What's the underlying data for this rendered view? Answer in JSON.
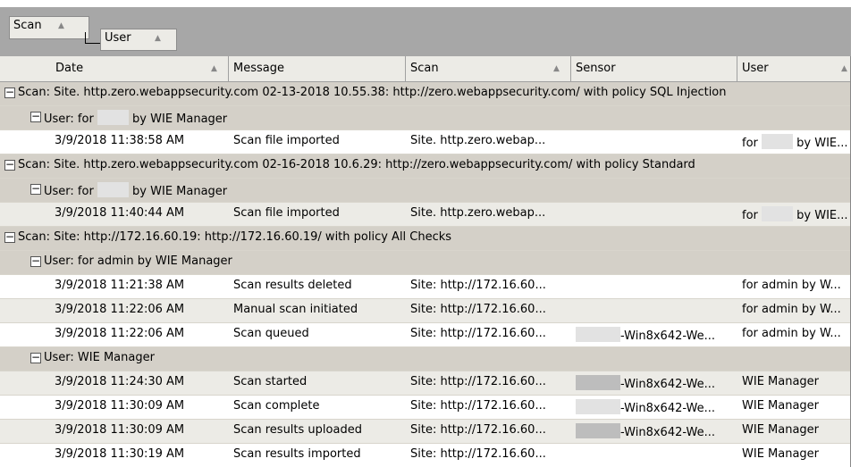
{
  "group_panel": {
    "chips": [
      {
        "label": "Scan",
        "sort": "ascending"
      },
      {
        "label": "User",
        "sort": "ascending"
      }
    ]
  },
  "columns": [
    {
      "label": "Date",
      "sort": "ascending"
    },
    {
      "label": "Message",
      "sort": ""
    },
    {
      "label": "Scan",
      "sort": "ascending"
    },
    {
      "label": "Sensor",
      "sort": ""
    },
    {
      "label": "User",
      "sort": "ascending"
    }
  ],
  "icons": {
    "sort_ascending": "▲",
    "collapse": "−"
  },
  "groups": [
    {
      "label": "Scan: Site. http.zero.webappsecurity.com 02-13-2018 10.55.38: http://zero.webappsecurity.com/ with policy SQL Injection",
      "subgroups": [
        {
          "label_before": "User: for ",
          "label_after": " by WIE Manager",
          "redacted": true,
          "rows": [
            {
              "date": "3/9/2018 11:38:58 AM",
              "message": "Scan file imported",
              "scan": "Site. http.zero.webap...",
              "sensor_before": "",
              "sensor_after": "",
              "user_before": "for ",
              "user_after": " by WIE...",
              "sensor_redacted": false,
              "user_redacted": true
            }
          ]
        }
      ]
    },
    {
      "label": "Scan: Site. http.zero.webappsecurity.com 02-16-2018 10.6.29: http://zero.webappsecurity.com/ with policy Standard",
      "subgroups": [
        {
          "label_before": "User: for ",
          "label_after": " by WIE Manager",
          "redacted": true,
          "rows": [
            {
              "date": "3/9/2018 11:40:44 AM",
              "message": "Scan file imported",
              "scan": "Site. http.zero.webap...",
              "sensor_before": "",
              "sensor_after": "",
              "user_before": "for ",
              "user_after": " by WIE...",
              "sensor_redacted": false,
              "user_redacted": true
            }
          ]
        }
      ]
    },
    {
      "label": "Scan: Site: http://172.16.60.19: http://172.16.60.19/ with policy All Checks",
      "subgroups": [
        {
          "label_before": "User: for admin by WIE Manager",
          "label_after": "",
          "redacted": false,
          "rows": [
            {
              "date": "3/9/2018 11:21:38 AM",
              "message": "Scan results deleted",
              "scan": "Site: http://172.16.60...",
              "sensor_before": "",
              "sensor_after": "",
              "user_before": "for admin by W...",
              "user_after": "",
              "sensor_redacted": false,
              "user_redacted": false
            },
            {
              "date": "3/9/2018 11:22:06 AM",
              "message": "Manual scan initiated",
              "scan": "Site: http://172.16.60...",
              "sensor_before": "",
              "sensor_after": "",
              "user_before": "for admin by W...",
              "user_after": "",
              "sensor_redacted": false,
              "user_redacted": false
            },
            {
              "date": "3/9/2018 11:22:06 AM",
              "message": "Scan queued",
              "scan": "Site: http://172.16.60...",
              "sensor_before": "",
              "sensor_after": "-Win8x642-We...",
              "user_before": "for admin by W...",
              "user_after": "",
              "sensor_redacted": true,
              "user_redacted": false
            }
          ]
        },
        {
          "label_before": "User: WIE Manager",
          "label_after": "",
          "redacted": false,
          "rows": [
            {
              "date": "3/9/2018 11:24:30 AM",
              "message": "Scan started",
              "scan": "Site: http://172.16.60...",
              "sensor_before": "",
              "sensor_after": "-Win8x642-We...",
              "user_before": "WIE Manager",
              "user_after": "",
              "sensor_redacted": true,
              "user_redacted": false
            },
            {
              "date": "3/9/2018 11:30:09 AM",
              "message": "Scan complete",
              "scan": "Site: http://172.16.60...",
              "sensor_before": "",
              "sensor_after": "-Win8x642-We...",
              "user_before": "WIE Manager",
              "user_after": "",
              "sensor_redacted": true,
              "user_redacted": false
            },
            {
              "date": "3/9/2018 11:30:09 AM",
              "message": "Scan results uploaded",
              "scan": "Site: http://172.16.60...",
              "sensor_before": "",
              "sensor_after": "-Win8x642-We...",
              "user_before": "WIE Manager",
              "user_after": "",
              "sensor_redacted": true,
              "user_redacted": false
            },
            {
              "date": "3/9/2018 11:30:19 AM",
              "message": "Scan results imported",
              "scan": "Site: http://172.16.60...",
              "sensor_before": "",
              "sensor_after": "",
              "user_before": "WIE Manager",
              "user_after": "",
              "sensor_redacted": false,
              "user_redacted": false
            }
          ]
        }
      ]
    }
  ]
}
